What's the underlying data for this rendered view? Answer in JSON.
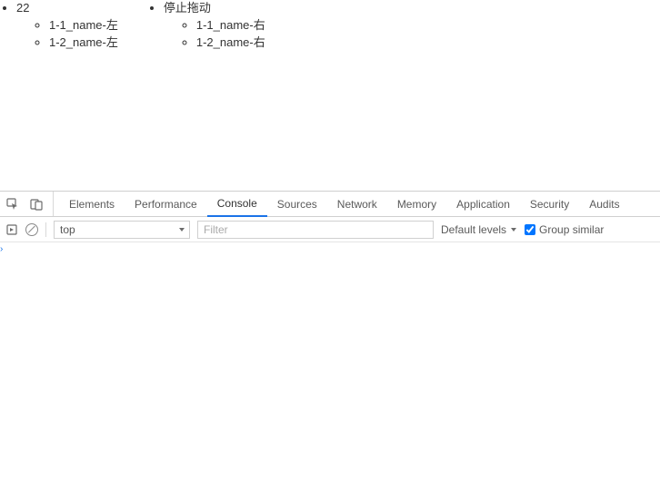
{
  "page": {
    "trees": [
      {
        "label": "22",
        "children": [
          {
            "label": "1-1_name-左"
          },
          {
            "label": "1-2_name-左"
          }
        ]
      },
      {
        "label": "停止拖动",
        "children": [
          {
            "label": "1-1_name-右"
          },
          {
            "label": "1-2_name-右"
          }
        ]
      }
    ]
  },
  "devtools": {
    "tabs": {
      "elements": "Elements",
      "performance": "Performance",
      "console": "Console",
      "sources": "Sources",
      "network": "Network",
      "memory": "Memory",
      "application": "Application",
      "security": "Security",
      "audits": "Audits"
    },
    "active_tab": "console",
    "toolbar": {
      "context": "top",
      "filter_placeholder": "Filter",
      "levels_label": "Default levels",
      "group_similar_label": "Group similar",
      "group_similar_checked": true
    }
  }
}
